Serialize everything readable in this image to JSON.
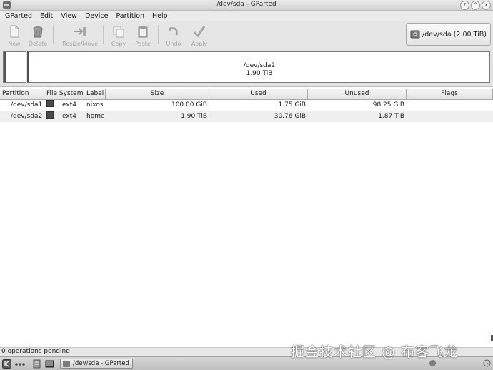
{
  "window": {
    "title": "/dev/sda - GParted",
    "controls": [
      "?",
      "^",
      "x"
    ]
  },
  "menu": {
    "items": [
      "GParted",
      "Edit",
      "View",
      "Device",
      "Partition",
      "Help"
    ]
  },
  "toolbar": {
    "new_label": "New",
    "delete_label": "Delete",
    "resize_label": "Resize/Move",
    "copy_label": "Copy",
    "paste_label": "Paste",
    "undo_label": "Undo",
    "apply_label": "Apply"
  },
  "device_selector": {
    "value": "/dev/sda  (2.00 TiB)"
  },
  "graph": {
    "partition_name": "/dev/sda2",
    "partition_size": "1.90 TiB"
  },
  "table": {
    "headers": {
      "partition": "Partition",
      "filesystem": "File System",
      "label": "Label",
      "size": "Size",
      "used": "Used",
      "unused": "Unused",
      "flags": "Flags"
    },
    "rows": [
      {
        "partition": "/dev/sda1",
        "filesystem": "ext4",
        "label": "nixos",
        "size": "100.00 GiB",
        "used": "1.75 GiB",
        "unused": "98.25 GiB",
        "flags": ""
      },
      {
        "partition": "/dev/sda2",
        "filesystem": "ext4",
        "label": "home",
        "size": "1.90 TiB",
        "used": "30.76 GiB",
        "unused": "1.87 TiB",
        "flags": ""
      }
    ]
  },
  "status": {
    "text": "0 operations pending"
  },
  "taskbar": {
    "task_label": "/dev/sda - GParted"
  },
  "watermark": {
    "text": "掘金技术社区 @ 布客飞龙"
  },
  "colors": {
    "filesystem_swatch": "#4a4a4a"
  }
}
